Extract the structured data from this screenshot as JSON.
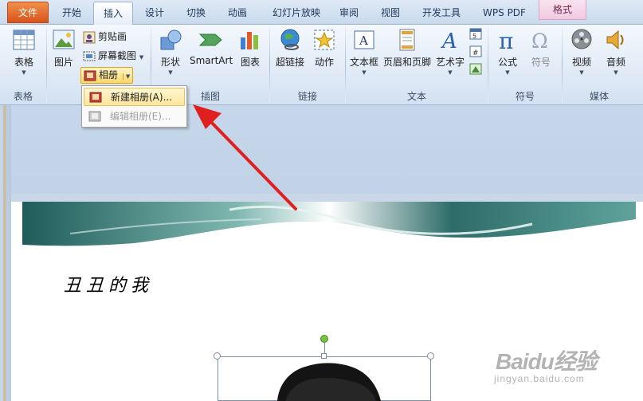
{
  "tabs": [
    {
      "label": "文件"
    },
    {
      "label": "开始"
    },
    {
      "label": "插入"
    },
    {
      "label": "设计"
    },
    {
      "label": "切换"
    },
    {
      "label": "动画"
    },
    {
      "label": "幻灯片放映"
    },
    {
      "label": "审阅"
    },
    {
      "label": "视图"
    },
    {
      "label": "开发工具"
    },
    {
      "label": "WPS PDF"
    },
    {
      "label": "格式"
    }
  ],
  "ribbon": {
    "groups": {
      "table": "表格",
      "image": "插图",
      "link": "链接",
      "text": "文本",
      "symbol": "符号",
      "media": "媒体"
    },
    "buttons": {
      "table": "表格",
      "picture": "图片",
      "clipart": "剪贴画",
      "screenshot": "屏幕截图",
      "album": "相册",
      "shapes": "形状",
      "smartart": "SmartArt",
      "chart": "图表",
      "hyperlink": "超链接",
      "action": "动作",
      "textbox": "文本框",
      "header_footer": "页眉和页脚",
      "wordart": "艺术字",
      "equation": "公式",
      "symbol": "符号",
      "video": "视频",
      "audio": "音频"
    }
  },
  "album_menu": {
    "new_album": "新建相册(A)...",
    "edit_album": "编辑相册(E)..."
  },
  "slide": {
    "title": "丑丑的我"
  },
  "watermark": {
    "brand": "Baidu经验",
    "sub": "jingyan.baidu.com"
  }
}
